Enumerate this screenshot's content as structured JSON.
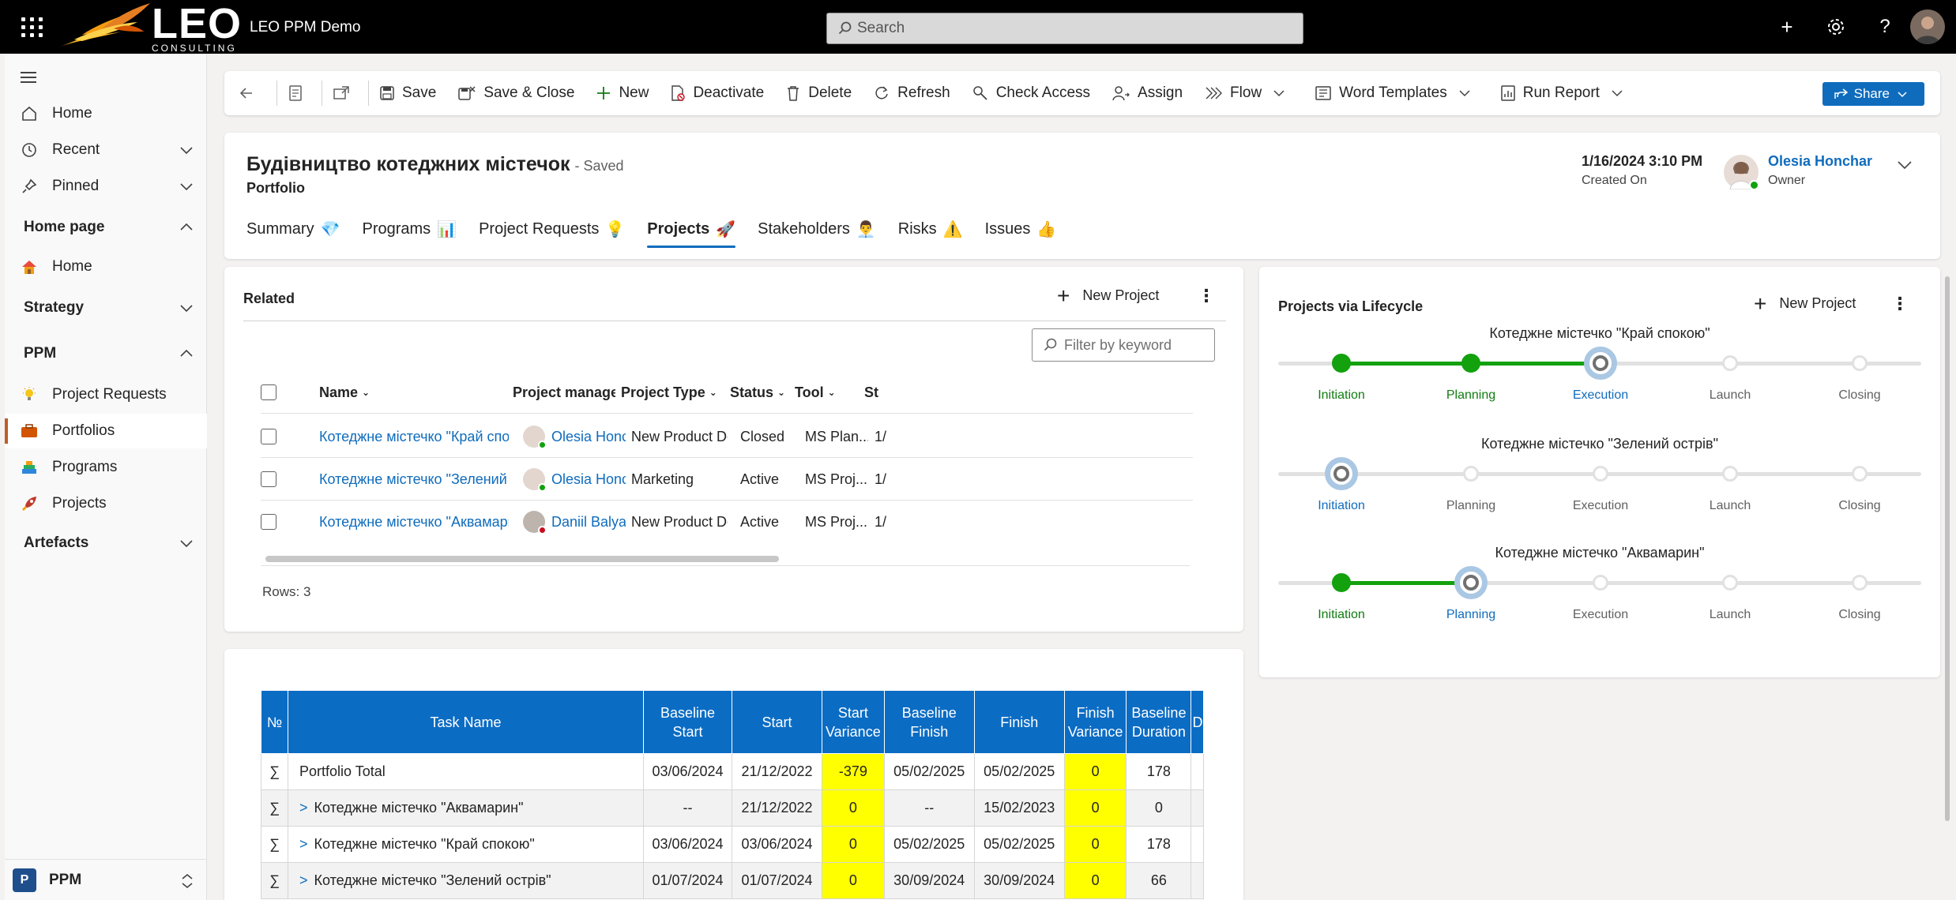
{
  "app": {
    "logo_text": "LEO",
    "logo_sub": "CONSULTING",
    "title": "LEO PPM Demo",
    "search_placeholder": "Search"
  },
  "sidebar": {
    "items": [
      {
        "label": "Home",
        "icon": "home-icon"
      },
      {
        "label": "Recent",
        "icon": "clock-icon"
      },
      {
        "label": "Pinned",
        "icon": "pin-icon"
      }
    ],
    "groups": [
      {
        "label": "Home page",
        "expanded": true,
        "items": [
          {
            "label": "Home",
            "icon": "house-color-icon"
          }
        ]
      },
      {
        "label": "Strategy",
        "expanded": false,
        "items": []
      },
      {
        "label": "PPM",
        "expanded": true,
        "items": [
          {
            "label": "Project Requests",
            "icon": "lightbulb-icon"
          },
          {
            "label": "Portfolios",
            "icon": "portfolio-icon",
            "active": true
          },
          {
            "label": "Programs",
            "icon": "programs-icon"
          },
          {
            "label": "Projects",
            "icon": "rocket-icon"
          }
        ]
      },
      {
        "label": "Artefacts",
        "expanded": false,
        "items": []
      }
    ],
    "area": {
      "badge": "P",
      "label": "PPM"
    }
  },
  "commands": {
    "save": "Save",
    "save_close": "Save & Close",
    "new": "New",
    "deactivate": "Deactivate",
    "delete": "Delete",
    "refresh": "Refresh",
    "check_access": "Check Access",
    "assign": "Assign",
    "flow": "Flow",
    "word_templates": "Word Templates",
    "run_report": "Run Report",
    "share": "Share"
  },
  "record": {
    "title": "Будівництво котеджних містечок",
    "saved": "- Saved",
    "entity": "Portfolio",
    "created_on_value": "1/16/2024 3:10 PM",
    "created_on_label": "Created On",
    "owner_name": "Olesia Honchar",
    "owner_label": "Owner"
  },
  "tabs": [
    {
      "label": "Summary",
      "emoji": "💎"
    },
    {
      "label": "Programs",
      "emoji": "📊"
    },
    {
      "label": "Project Requests",
      "emoji": "💡"
    },
    {
      "label": "Projects",
      "emoji": "🚀",
      "active": true
    },
    {
      "label": "Stakeholders",
      "emoji": "👨‍💼"
    },
    {
      "label": "Risks",
      "emoji": "⚠️"
    },
    {
      "label": "Issues",
      "emoji": "👍"
    }
  ],
  "related": {
    "title": "Related",
    "new_project": "New Project",
    "filter_placeholder": "Filter by keyword",
    "columns": [
      "Name",
      "Project manager",
      "Project Type",
      "Status",
      "Tool",
      "St"
    ],
    "rows": [
      {
        "name": "Котеджне містечко \"Край спокою\"",
        "manager": "Olesia Honchar (Av...",
        "type": "New Product Devel...",
        "status": "Closed",
        "tool": "MS Plan...",
        "st": "1/"
      },
      {
        "name": "Котеджне містечко \"Зелений острів\"",
        "manager": "Olesia Honchar (Av...",
        "type": "Marketing",
        "status": "Active",
        "tool": "MS Proj...",
        "st": "1/"
      },
      {
        "name": "Котеджне містечко \"Аквамарин\"",
        "manager": "Daniil Balya (Busy)",
        "type": "New Product Devel...",
        "status": "Active",
        "tool": "MS Proj...",
        "st": "1/"
      }
    ],
    "rows_count": "Rows: 3"
  },
  "lifecycle": {
    "title": "Projects via Lifecycle",
    "new_project": "New Project",
    "stages": [
      "Initiation",
      "Planning",
      "Execution",
      "Launch",
      "Closing"
    ],
    "projects": [
      {
        "name": "Котеджне містечко \"Край спокою\"",
        "current_stage": 2
      },
      {
        "name": "Котеджне містечко \"Зелений острів\"",
        "current_stage": 0
      },
      {
        "name": "Котеджне містечко \"Аквамарин\"",
        "current_stage": 1
      }
    ]
  },
  "tasks": {
    "columns": [
      "№",
      "Task Name",
      "Baseline Start",
      "Start",
      "Start Variance",
      "Baseline Finish",
      "Finish",
      "Finish Variance",
      "Baseline Duration",
      "D"
    ],
    "rows": [
      {
        "n": "∑",
        "name": "Portfolio Total",
        "bstart": "03/06/2024",
        "start": "21/12/2022",
        "svar": "-379",
        "bfinish": "05/02/2025",
        "finish": "05/02/2025",
        "fvar": "0",
        "bdur": "178",
        "child": false
      },
      {
        "n": "∑",
        "name": "Котеджне містечко \"Аквамарин\"",
        "bstart": "--",
        "start": "21/12/2022",
        "svar": "0",
        "bfinish": "--",
        "finish": "15/02/2023",
        "fvar": "0",
        "bdur": "0",
        "child": true
      },
      {
        "n": "∑",
        "name": "Котеджне містечко \"Край спокою\"",
        "bstart": "03/06/2024",
        "start": "03/06/2024",
        "svar": "0",
        "bfinish": "05/02/2025",
        "finish": "05/02/2025",
        "fvar": "0",
        "bdur": "178",
        "child": true
      },
      {
        "n": "∑",
        "name": "Котеджне містечко \"Зелений острів\"",
        "bstart": "01/07/2024",
        "start": "01/07/2024",
        "svar": "0",
        "bfinish": "30/09/2024",
        "finish": "30/09/2024",
        "fvar": "0",
        "bdur": "66",
        "child": true
      }
    ]
  },
  "colors": {
    "accent": "#0f6cbd",
    "success": "#13a10e",
    "highlight": "#ffff00",
    "table_header": "#0b6cc4"
  }
}
